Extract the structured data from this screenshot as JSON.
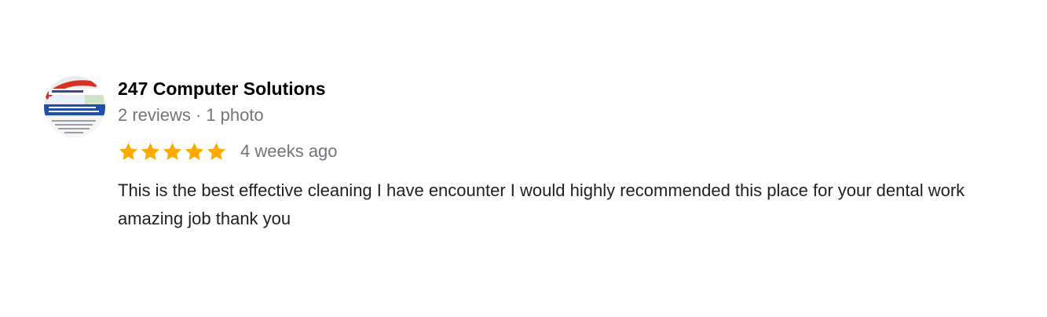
{
  "review": {
    "reviewer_name": "247 Computer Solutions",
    "review_count": "2 reviews",
    "separator": "·",
    "photo_count": "1 photo",
    "rating": 5,
    "rating_max": 5,
    "star_color": "#f9ab00",
    "date": "4 weeks ago",
    "text": "This is the best effective cleaning I have encounter I would highly recommended this place for your dental work amazing job thank you"
  }
}
